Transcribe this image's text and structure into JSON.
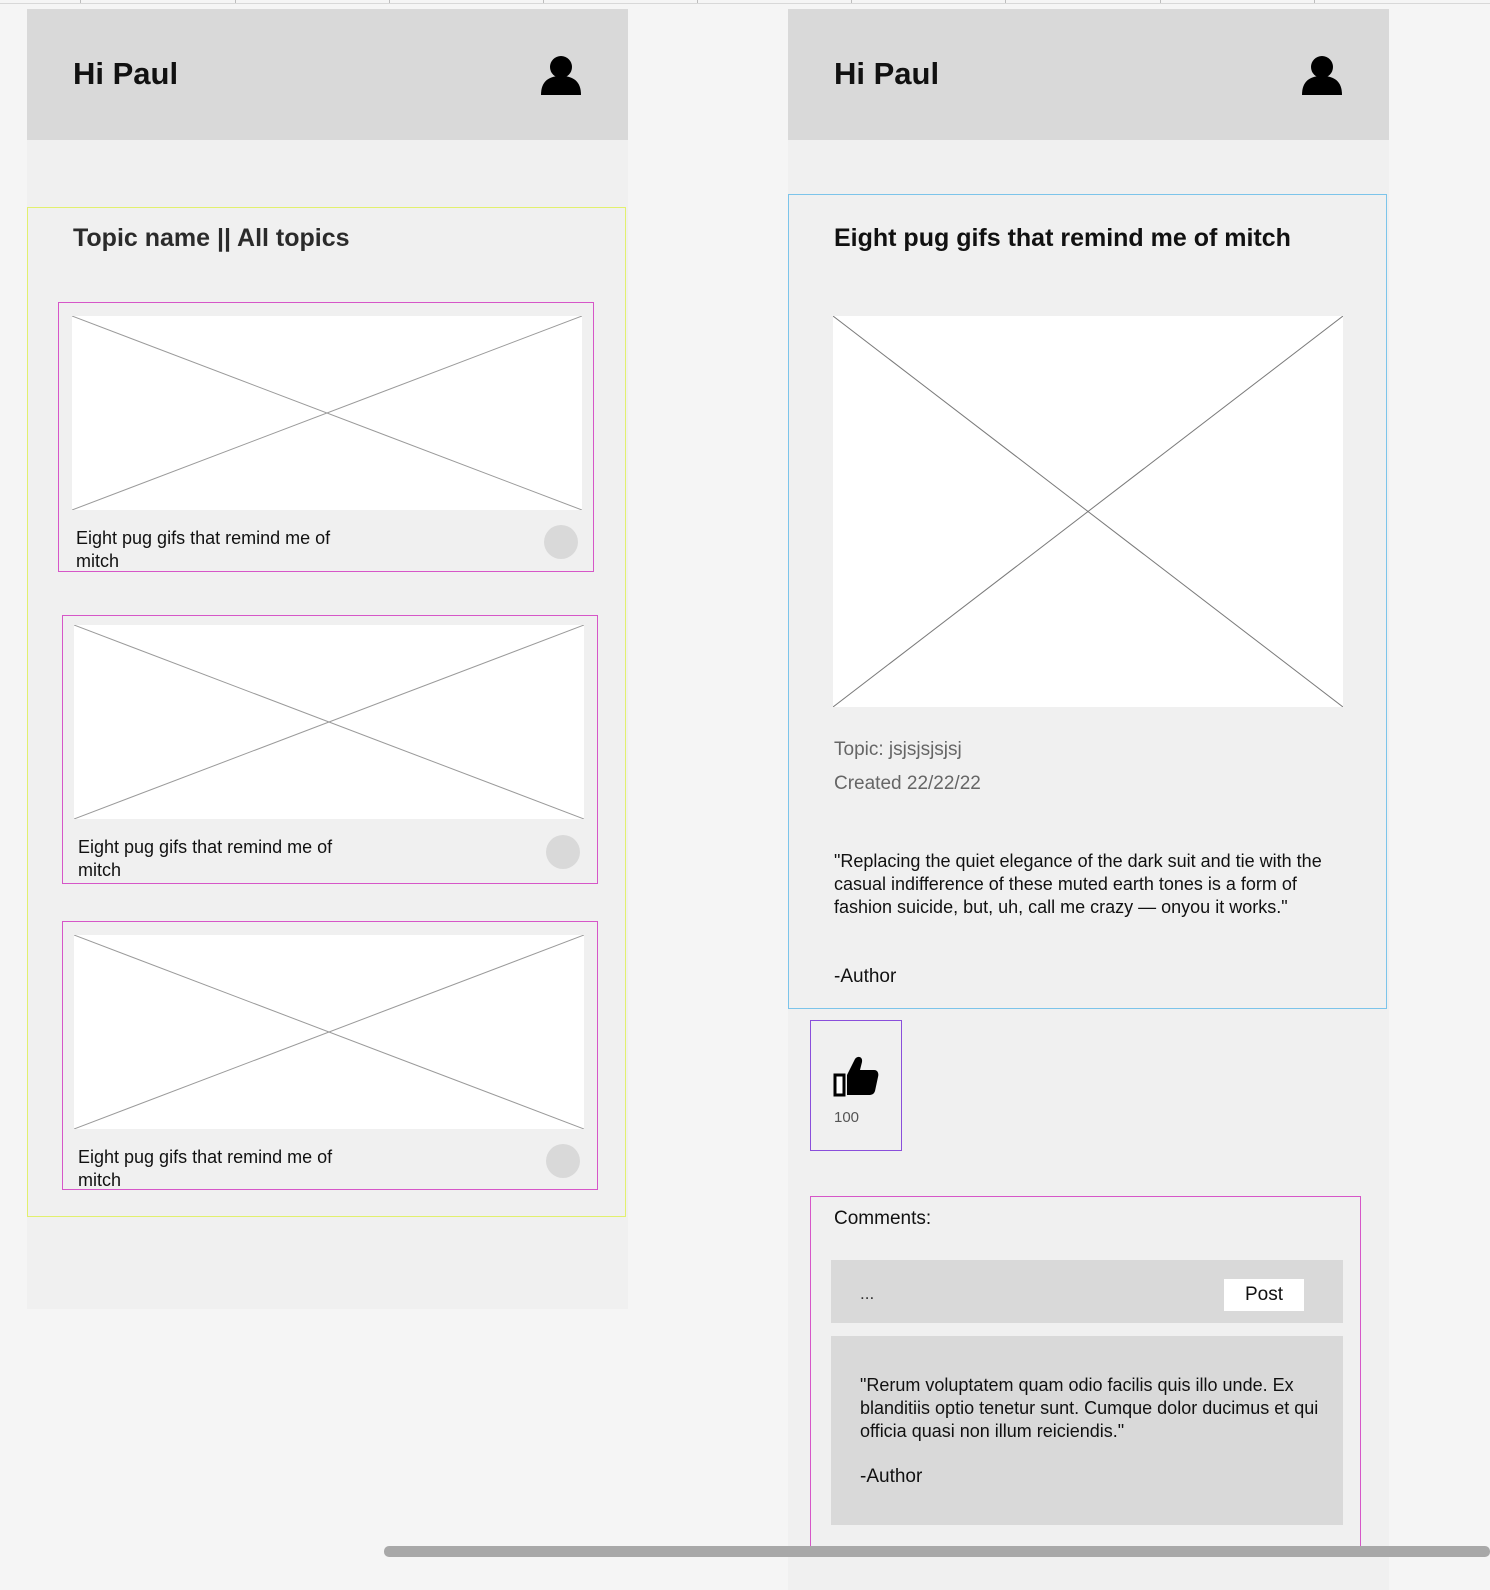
{
  "left_screen": {
    "header": {
      "greeting": "Hi Paul",
      "avatar_icon": "user-avatar-icon"
    },
    "section_title": "Topic name || All topics",
    "cards": [
      {
        "title": "Eight pug gifs that remind me of mitch"
      },
      {
        "title": "Eight pug gifs that remind me of mitch"
      },
      {
        "title": "Eight pug gifs that remind me of mitch"
      }
    ]
  },
  "right_screen": {
    "header": {
      "greeting": "Hi Paul",
      "avatar_icon": "user-avatar-icon"
    },
    "post": {
      "title": "Eight pug gifs that remind me of mitch",
      "topic": "Topic: jsjsjsjsjsj",
      "created": "Created 22/22/22",
      "quote": "\"Replacing the quiet elegance of the dark suit and tie with the casual indifference of these muted earth tones is a form of fashion suicide, but, uh, call me crazy — onyou it works.\"",
      "author": "-Author"
    },
    "likes": {
      "icon": "thumbs-up-icon",
      "count": "100"
    },
    "comments": {
      "label": "Comments:",
      "input_value": "...",
      "post_label": "Post",
      "items": [
        {
          "text": "\"Rerum voluptatem quam odio facilis quis illo unde. Ex blanditiis optio tenetur sunt. Cumque dolor ducimus et qui officia quasi non illum reiciendis.\"",
          "author": "-Author"
        }
      ]
    }
  },
  "colors": {
    "header_bg": "#d9d9d9",
    "frame_bg": "#f0f0f0",
    "section_outline": "#e2f06e",
    "card_outline": "#d656c8",
    "post_outline": "#7cc4ea",
    "like_outline": "#8a4fdb"
  }
}
